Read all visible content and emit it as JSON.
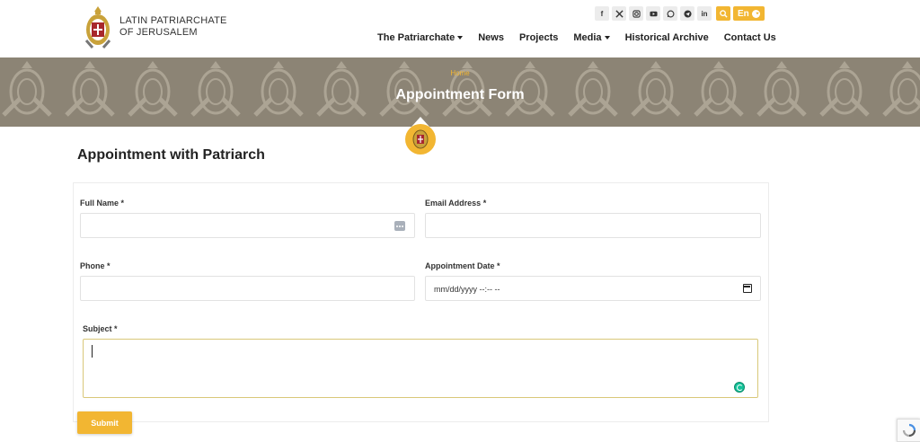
{
  "header": {
    "logo": {
      "line1": "LATIN PATRIARCHATE",
      "line2": "OF JERUSALEM"
    },
    "social": [
      {
        "name": "facebook-icon",
        "glyph": "f"
      },
      {
        "name": "x-twitter-icon",
        "glyph": "𝕏"
      },
      {
        "name": "instagram-icon",
        "glyph": "◎"
      },
      {
        "name": "youtube-icon",
        "glyph": "▶"
      },
      {
        "name": "whatsapp-icon",
        "glyph": "✆"
      },
      {
        "name": "telegram-icon",
        "glyph": "➤"
      },
      {
        "name": "linkedin-icon",
        "glyph": "in"
      }
    ],
    "language_label": "En",
    "nav": {
      "patriarchate": "The Patriarchate",
      "news": "News",
      "projects": "Projects",
      "media": "Media",
      "archive": "Historical Archive",
      "contact": "Contact Us"
    }
  },
  "banner": {
    "breadcrumb": "Home",
    "title": "Appointment Form"
  },
  "main": {
    "heading": "Appointment with Patriarch",
    "form": {
      "full_name_label": "Full Name",
      "email_label": "Email Address",
      "phone_label": "Phone",
      "date_label": "Appointment Date",
      "date_placeholder": "mm/dd/yyyy --:-- --",
      "subject_label": "Subject",
      "required_mark": "*",
      "submit_label": "Submit"
    }
  },
  "colors": {
    "accent": "#f2b632",
    "banner": "#8c8475",
    "text": "#222222"
  }
}
